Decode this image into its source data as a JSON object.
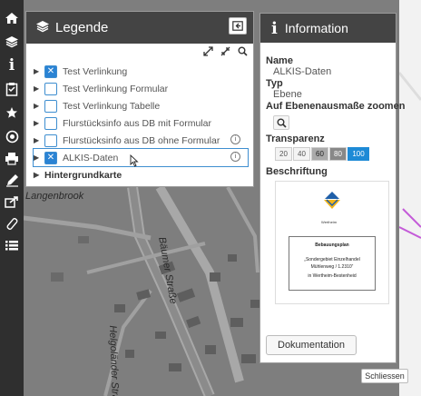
{
  "legend": {
    "title": "Legende",
    "layers": [
      {
        "label": "Test Verlinkung",
        "checked": true,
        "info": false
      },
      {
        "label": "Test Verlinkung Formular",
        "checked": false,
        "info": false
      },
      {
        "label": "Test Verlinkung Tabelle",
        "checked": false,
        "info": false
      },
      {
        "label": "Flurstücksinfo aus DB mit Formular",
        "checked": false,
        "info": false
      },
      {
        "label": "Flurstücksinfo aus DB ohne Formular",
        "checked": false,
        "info": true
      },
      {
        "label": "ALKIS-Daten",
        "checked": true,
        "info": true,
        "selected": true
      }
    ],
    "group": "Hintergrundkarte",
    "info_glyph": "i"
  },
  "info": {
    "title": "Information",
    "name_label": "Name",
    "name_value": "ALKIS-Daten",
    "type_label": "Typ",
    "type_value": "Ebene",
    "zoom_label": "Auf Ebenenausmaße zoomen",
    "transparency_label": "Transparenz",
    "transparency_options": [
      "20",
      "40",
      "60",
      "80",
      "100"
    ],
    "transparency_selected": "100",
    "caption_label": "Beschriftung",
    "doc": {
      "logo_text": "Wertheim",
      "line1": "Bebauungsplan",
      "line2": "„Sondergebiet Einzelhandel",
      "line3": "Mühlenweg / 1.2310“",
      "line4": "in Wertheim-Bestenheid"
    },
    "doc_button": "Dokumentation"
  },
  "close_button": "Schliessen",
  "map": {
    "labels": {
      "langenbrook": "Langenbrook",
      "street1": "Bäumer Straße",
      "street2": "Helgoländer Straße"
    }
  },
  "toolbar": {
    "icons": [
      "home-icon",
      "layers-icon",
      "info-icon",
      "clipboard-icon",
      "star-icon",
      "target-icon",
      "print-icon",
      "edit-icon",
      "share-icon",
      "measure-icon",
      "list-icon"
    ]
  },
  "colors": {
    "panel_header": "#444444",
    "checkbox_blue": "#2a83d4",
    "transparency_active": "#1e8ad6",
    "toolbar": "#2f2f2f"
  }
}
